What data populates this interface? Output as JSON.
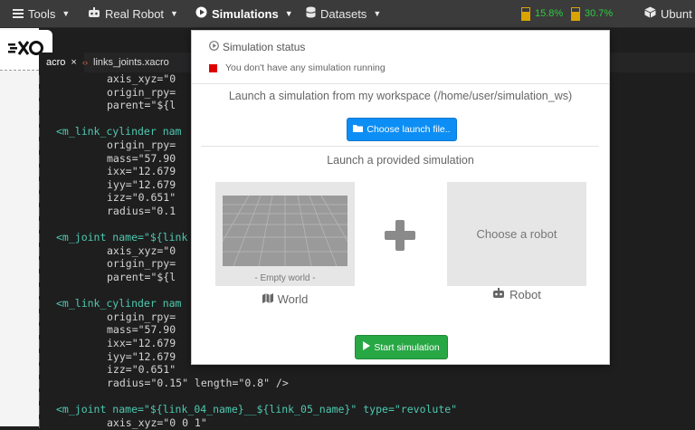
{
  "navbar": {
    "tools": "Tools",
    "real_robot": "Real Robot",
    "simulations": "Simulations",
    "datasets": "Datasets",
    "cpu": "15.8%",
    "memory": "30.7%",
    "os": "Ubunt"
  },
  "editor": {
    "tabs": [
      {
        "label": "acro",
        "close": "×"
      },
      {
        "label": "links_joints.xacro"
      }
    ],
    "code_lines": [
      {
        "indent": "          ",
        "text": "axis_xyz=\"0"
      },
      {
        "indent": "          ",
        "text": "origin_rpy="
      },
      {
        "indent": "          ",
        "text": "parent=\"${l"
      },
      {
        "indent": "",
        "text": ""
      },
      {
        "indent": "  ",
        "text": "<m_link_cylinder nam"
      },
      {
        "indent": "          ",
        "text": "origin_rpy="
      },
      {
        "indent": "          ",
        "text": "mass=\"57.90"
      },
      {
        "indent": "          ",
        "text": "ixx=\"12.679"
      },
      {
        "indent": "          ",
        "text": "iyy=\"12.679"
      },
      {
        "indent": "          ",
        "text": "izz=\"0.651\""
      },
      {
        "indent": "          ",
        "text": "radius=\"0.1"
      },
      {
        "indent": "",
        "text": ""
      },
      {
        "indent": "  ",
        "text": "<m_joint name=\"${link"
      },
      {
        "indent": "          ",
        "text": "axis_xyz=\"0"
      },
      {
        "indent": "          ",
        "text": "origin_rpy="
      },
      {
        "indent": "          ",
        "text": "parent=\"${l"
      },
      {
        "indent": "",
        "text": ""
      },
      {
        "indent": "  ",
        "text": "<m_link_cylinder nam"
      },
      {
        "indent": "          ",
        "text": "origin_rpy="
      },
      {
        "indent": "          ",
        "text": "mass=\"57.90"
      },
      {
        "indent": "          ",
        "text": "ixx=\"12.679"
      },
      {
        "indent": "          ",
        "text": "iyy=\"12.679"
      },
      {
        "indent": "          ",
        "text": "izz=\"0.651\""
      },
      {
        "indent": "          ",
        "text": "radius=\"0.15\" length=\"0.8\" />"
      },
      {
        "indent": "",
        "text": ""
      },
      {
        "indent": "  ",
        "text": "<m_joint name=\"${link_04_name}__${link_05_name}\" type=\"revolute\""
      },
      {
        "indent": "          ",
        "text": "axis_xyz=\"0 0 1\""
      }
    ]
  },
  "modal": {
    "status_title": "Simulation status",
    "status_message": "You don't have any simulation running",
    "workspace_title": "Launch a simulation from my workspace (/home/user/simulation_ws)",
    "choose_launch_button": "Choose launch file..",
    "provided_title": "Launch a provided simulation",
    "world_caption": "- Empty world -",
    "world_label": "World",
    "robot_placeholder": "Choose a robot",
    "robot_label": "Robot",
    "start_button": "Start simulation"
  }
}
